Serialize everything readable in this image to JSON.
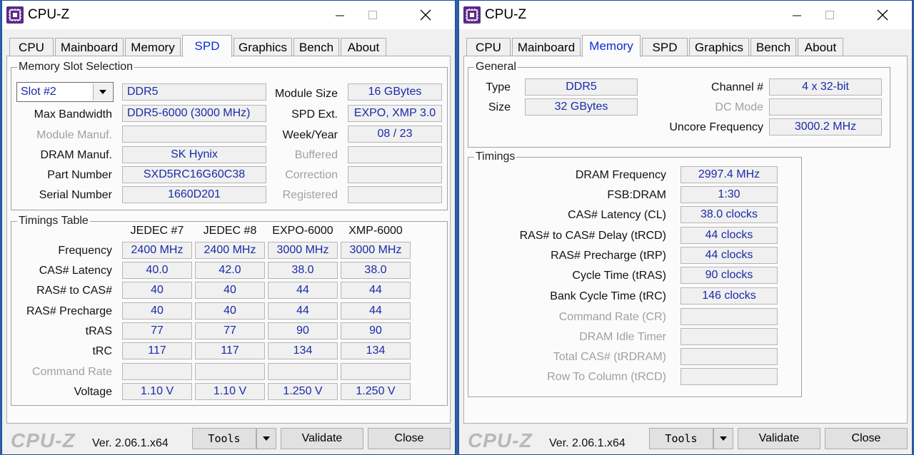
{
  "brand": "CPU-Z",
  "version": "Ver. 2.06.1.x64",
  "buttons": {
    "tools": "Tools",
    "validate": "Validate",
    "close": "Close"
  },
  "tabs": [
    "CPU",
    "Mainboard",
    "Memory",
    "SPD",
    "Graphics",
    "Bench",
    "About"
  ],
  "w1": {
    "title": "CPU-Z",
    "active_tab": "SPD",
    "slot": {
      "legend": "Memory Slot Selection",
      "selected": "Slot #2",
      "type": "DDR5",
      "labels": {
        "max_bandwidth": "Max Bandwidth",
        "module_manuf": "Module Manuf.",
        "dram_manuf": "DRAM Manuf.",
        "part_number": "Part Number",
        "serial_number": "Serial Number",
        "module_size": "Module Size",
        "spd_ext": "SPD Ext.",
        "week_year": "Week/Year",
        "buffered": "Buffered",
        "correction": "Correction",
        "registered": "Registered"
      },
      "values": {
        "max_bandwidth": "DDR5-6000 (3000 MHz)",
        "module_manuf": "",
        "dram_manuf": "SK Hynix",
        "part_number": "SXD5RC16G60C38",
        "serial_number": "1660D201",
        "module_size": "16 GBytes",
        "spd_ext": "EXPO, XMP 3.0",
        "week_year": "08 / 23",
        "buffered": "",
        "correction": "",
        "registered": ""
      }
    },
    "timings": {
      "legend": "Timings Table",
      "columns": [
        "JEDEC #7",
        "JEDEC #8",
        "EXPO-6000",
        "XMP-6000"
      ],
      "rows": [
        {
          "label": "Frequency",
          "values": [
            "2400 MHz",
            "2400 MHz",
            "3000 MHz",
            "3000 MHz"
          ]
        },
        {
          "label": "CAS# Latency",
          "values": [
            "40.0",
            "42.0",
            "38.0",
            "38.0"
          ]
        },
        {
          "label": "RAS# to CAS#",
          "values": [
            "40",
            "40",
            "44",
            "44"
          ]
        },
        {
          "label": "RAS# Precharge",
          "values": [
            "40",
            "40",
            "44",
            "44"
          ]
        },
        {
          "label": "tRAS",
          "values": [
            "77",
            "77",
            "90",
            "90"
          ]
        },
        {
          "label": "tRC",
          "values": [
            "117",
            "117",
            "134",
            "134"
          ]
        },
        {
          "label": "Command Rate",
          "values": [
            "",
            "",
            "",
            ""
          ]
        },
        {
          "label": "Voltage",
          "values": [
            "1.10 V",
            "1.10 V",
            "1.250 V",
            "1.250 V"
          ]
        }
      ]
    }
  },
  "w2": {
    "title": "CPU-Z",
    "active_tab": "Memory",
    "general": {
      "legend": "General",
      "labels": {
        "type": "Type",
        "size": "Size",
        "channel": "Channel #",
        "dc_mode": "DC Mode",
        "uncore": "Uncore Frequency"
      },
      "values": {
        "type": "DDR5",
        "size": "32 GBytes",
        "channel": "4 x 32-bit",
        "dc_mode": "",
        "uncore": "3000.2 MHz"
      }
    },
    "timings": {
      "legend": "Timings",
      "rows": [
        {
          "label": "DRAM Frequency",
          "value": "2997.4 MHz"
        },
        {
          "label": "FSB:DRAM",
          "value": "1:30"
        },
        {
          "label": "CAS# Latency (CL)",
          "value": "38.0 clocks"
        },
        {
          "label": "RAS# to CAS# Delay (tRCD)",
          "value": "44 clocks"
        },
        {
          "label": "RAS# Precharge (tRP)",
          "value": "44 clocks"
        },
        {
          "label": "Cycle Time (tRAS)",
          "value": "90 clocks"
        },
        {
          "label": "Bank Cycle Time (tRC)",
          "value": "146 clocks"
        },
        {
          "label": "Command Rate (CR)",
          "value": ""
        },
        {
          "label": "DRAM Idle Timer",
          "value": ""
        },
        {
          "label": "Total CAS# (tRDRAM)",
          "value": ""
        },
        {
          "label": "Row To Column (tRCD)",
          "value": ""
        }
      ]
    }
  }
}
